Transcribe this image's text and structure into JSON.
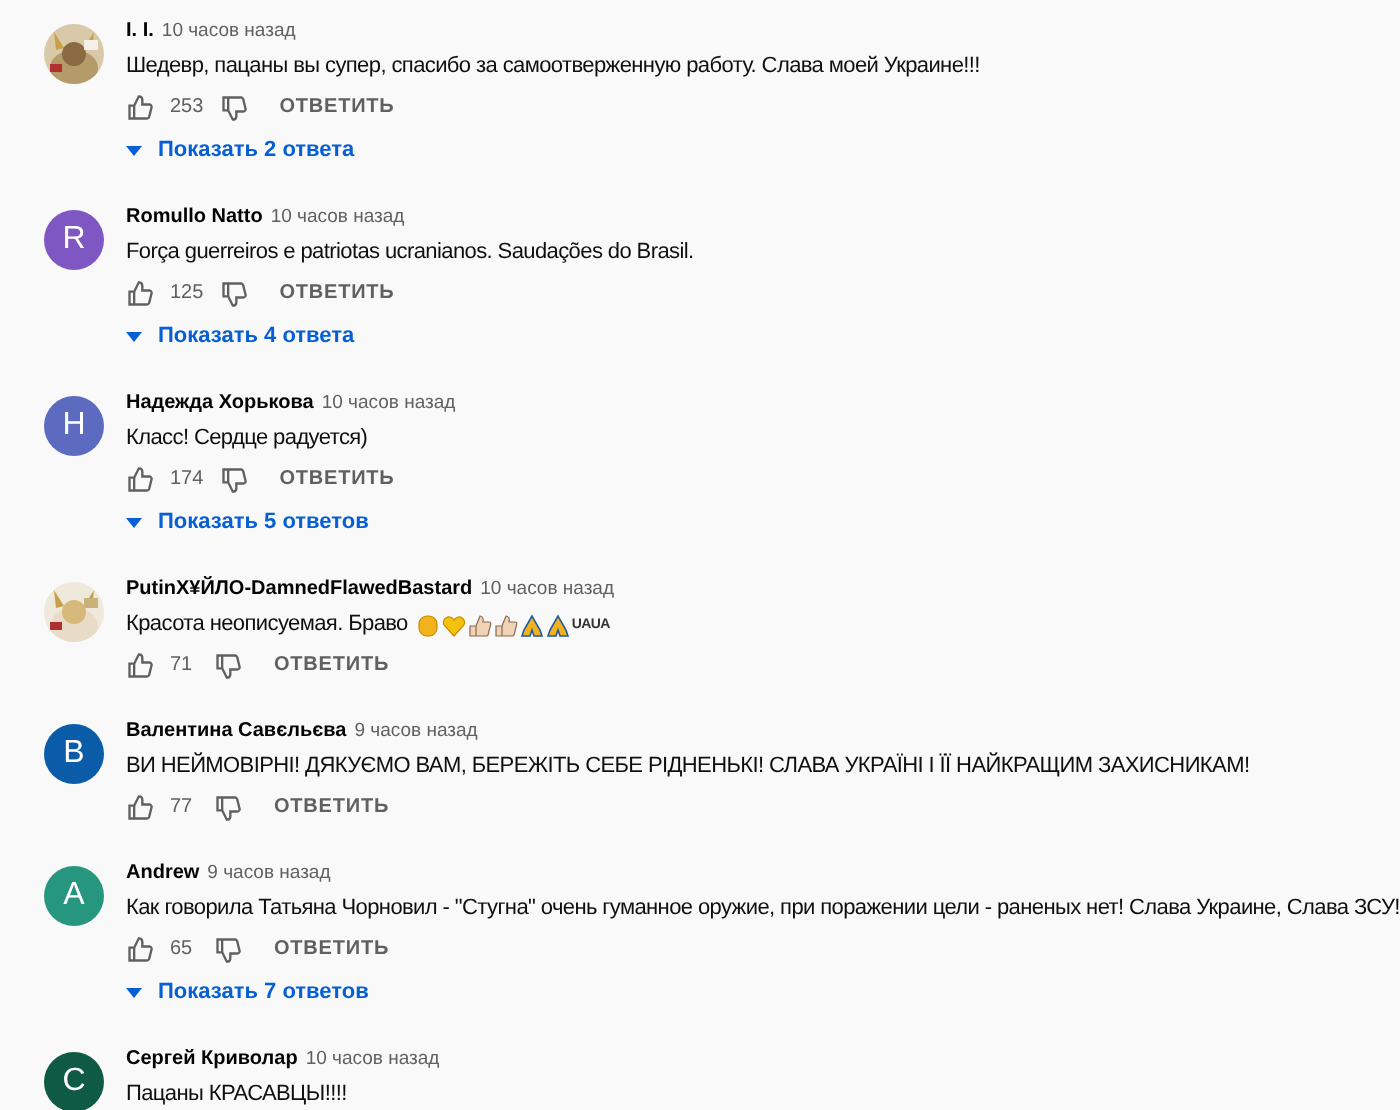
{
  "comments": [
    {
      "avatar": {
        "kind": "picture"
      },
      "author": "I. I.",
      "time": "10 часов назад",
      "text": "Шедевр, пацаны вы супер, спасибо за самоотверженную работу. Слава моей Украине!!!",
      "likes": "253",
      "reply": "ОТВЕТИТЬ",
      "replies": "Показать 2 ответа"
    },
    {
      "avatar": {
        "kind": "letter",
        "letter": "R",
        "color": "#7e57c2"
      },
      "author": "Romullo Natto",
      "time": "10 часов назад",
      "text": "Força guerreiros e patriotas ucranianos. Saudações do Brasil.",
      "likes": "125",
      "reply": "ОТВЕТИТЬ",
      "replies": "Показать 4 ответа"
    },
    {
      "avatar": {
        "kind": "letter",
        "letter": "H",
        "color": "#5c6bc0"
      },
      "author": "Надежда Хорькова",
      "time": "10 часов назад",
      "text": "Класс! Сердце радуется)",
      "likes": "174",
      "reply": "ОТВЕТИТЬ",
      "replies": "Показать 5 ответов"
    },
    {
      "avatar": {
        "kind": "picture"
      },
      "author": "PutinX¥ЙЛО-DamnedFlawedBastard",
      "time": "10 часов назад",
      "text": "Красота неописуемая. Браво",
      "emoji": [
        {
          "kind": "fist"
        },
        {
          "kind": "heart"
        },
        {
          "kind": "thumb"
        },
        {
          "kind": "thumb"
        },
        {
          "kind": "pray"
        },
        {
          "kind": "pray"
        }
      ],
      "tag": "UAUA",
      "likes": "71",
      "reply": "ОТВЕТИТЬ"
    },
    {
      "avatar": {
        "kind": "letter",
        "letter": "B",
        "color": "#0b5ca8"
      },
      "author": "Валентина Савєльєва",
      "time": "9 часов назад",
      "text": "ВИ НЕЙМОВІРНІ! ДЯКУЄМО ВАМ, БЕРЕЖІТЬ СЕБЕ РІДНЕНЬКІ! СЛАВА УКРАЇНІ І ЇЇ НАЙКРАЩИМ ЗАХИСНИКАМ!",
      "likes": "77",
      "reply": "ОТВЕТИТЬ"
    },
    {
      "avatar": {
        "kind": "letter",
        "letter": "A",
        "color": "#26977e"
      },
      "author": "Andrew",
      "time": "9 часов назад",
      "text": "Как говорила Татьяна Чорновил - \"Стугна\" очень гуманное оружие, при поражении цели - раненых нет! Слава Украине, Слава ЗСУ!",
      "likes": "65",
      "reply": "ОТВЕТИТЬ",
      "replies": "Показать 7 ответов"
    },
    {
      "avatar": {
        "kind": "letter",
        "letter": "C",
        "color": "#0f5a44"
      },
      "author": "Сергей Криволар",
      "time": "10 часов назад",
      "text": "Пацаны  КРАСАВЦЫ!!!!"
    }
  ]
}
